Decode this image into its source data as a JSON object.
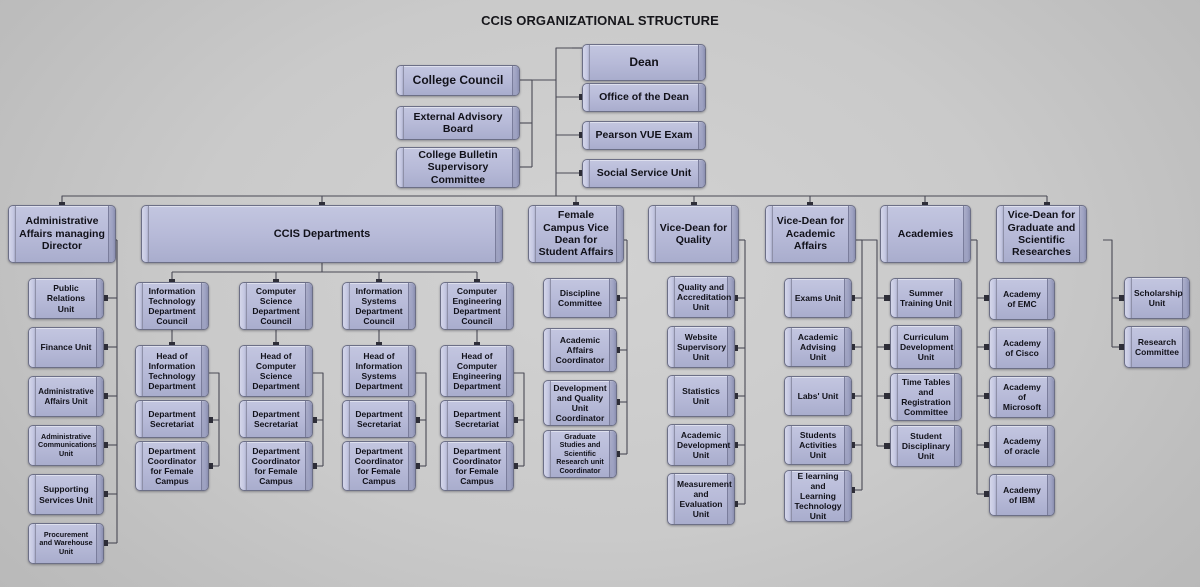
{
  "title": "CCIS ORGANIZATIONAL STRUCTURE",
  "colors": {
    "box_fill": "#b7bad8",
    "box_border": "#6c6f86",
    "background": "#cacaca",
    "connector": "#4a4a55",
    "text": "#111119"
  },
  "chart_data": {
    "type": "diagram",
    "title": "CCIS ORGANIZATIONAL STRUCTURE",
    "nodes": [
      {
        "id": "dean",
        "label": "Dean"
      },
      {
        "id": "office_of_dean",
        "label": "Office of the Dean"
      },
      {
        "id": "pearson_vue",
        "label": "Pearson VUE Exam"
      },
      {
        "id": "social_service",
        "label": "Social Service Unit"
      },
      {
        "id": "college_council",
        "label": "College Council"
      },
      {
        "id": "external_advisory",
        "label": "External Advisory Board"
      },
      {
        "id": "bulletin",
        "label": "College Bulletin Supervisory Committee"
      },
      {
        "id": "admin_affairs_dir",
        "label": "Administrative Affairs managing Director"
      },
      {
        "id": "ccis_departments",
        "label": "CCIS Departments"
      },
      {
        "id": "female_campus_vd",
        "label": "Female Campus Vice Dean for Student Affairs"
      },
      {
        "id": "vd_quality",
        "label": "Vice-Dean for Quality"
      },
      {
        "id": "vd_academic",
        "label": "Vice-Dean for Academic Affairs"
      },
      {
        "id": "academies",
        "label": "Academies"
      },
      {
        "id": "vd_graduate",
        "label": "Vice-Dean for Graduate and Scientific Researches"
      }
    ],
    "edges": [
      {
        "from": "dean",
        "to": "college_council"
      },
      {
        "from": "dean",
        "to": "external_advisory"
      },
      {
        "from": "dean",
        "to": "bulletin"
      },
      {
        "from": "dean",
        "to": "office_of_dean"
      },
      {
        "from": "dean",
        "to": "pearson_vue"
      },
      {
        "from": "dean",
        "to": "social_service"
      },
      {
        "from": "dean",
        "to": "admin_affairs_dir"
      },
      {
        "from": "dean",
        "to": "ccis_departments"
      },
      {
        "from": "dean",
        "to": "female_campus_vd"
      },
      {
        "from": "dean",
        "to": "vd_quality"
      },
      {
        "from": "dean",
        "to": "vd_academic"
      },
      {
        "from": "dean",
        "to": "academies"
      },
      {
        "from": "dean",
        "to": "vd_graduate"
      }
    ]
  },
  "top": {
    "dean": "Dean",
    "office_of_the_dean": "Office of the Dean",
    "pearson_vue_exam": "Pearson VUE Exam",
    "social_service_unit": "Social Service Unit",
    "college_council": "College Council",
    "external_advisory_board": "External Advisory Board",
    "college_bulletin": "College Bulletin Supervisory Committee"
  },
  "main_row": {
    "admin_affairs_director": "Administrative Affairs managing Director",
    "ccis_departments": "CCIS Departments",
    "female_campus_vice_dean": "Female Campus Vice Dean for Student Affairs",
    "vice_dean_quality": "Vice-Dean for Quality",
    "vice_dean_academic": "Vice-Dean for Academic Affairs",
    "academies": "Academies",
    "vice_dean_graduate": "Vice-Dean for Graduate and Scientific Researches"
  },
  "admin_units": [
    "Public Relations Unit",
    "Finance Unit",
    "Administrative Affairs Unit",
    "Administrative Communications Unit",
    "Supporting Services Unit",
    "Procurement and Warehouse Unit"
  ],
  "departments": [
    {
      "council": "Information Technology Department Council",
      "head": "Head of Information Technology Department",
      "secretariat": "Department Secretariat",
      "coordinator": "Department Coordinator for Female Campus"
    },
    {
      "council": "Computer Science Department Council",
      "head": "Head of Computer Science Department",
      "secretariat": "Department Secretariat",
      "coordinator": "Department Coordinator for Female Campus"
    },
    {
      "council": "Information Systems Department Council",
      "head": "Head of Information Systems Department",
      "secretariat": "Department Secretariat",
      "coordinator": "Department Coordinator for Female Campus"
    },
    {
      "council": "Computer Engineering Department Council",
      "head": "Head of Computer Engineering Department",
      "secretariat": "Department Secretariat",
      "coordinator": "Department Coordinator for Female Campus"
    }
  ],
  "female_campus_units": [
    "Discipline Committee",
    "Academic Affairs Coordinator",
    "Development and Quality Unit Coordinator",
    "Graduate Studies and Scientific Research unit Coordinator"
  ],
  "quality_units": [
    "Quality and Accreditation Unit",
    "Website Supervisory Unit",
    "Statistics Unit",
    "Academic Development Unit",
    "Measurement and Evaluation Unit"
  ],
  "academic_units_left": [
    "Exams Unit",
    "Academic Advising Unit",
    "Labs' Unit",
    "Students Activities Unit",
    "E learning and Learning Technology Unit"
  ],
  "academic_units_right": [
    "Summer Training Unit",
    "Curriculum Development Unit",
    "Time Tables and Registration Committee",
    "Student Disciplinary Unit"
  ],
  "academy_units": [
    "Academy of EMC",
    "Academy of Cisco",
    "Academy of Microsoft",
    "Academy of oracle",
    "Academy of IBM"
  ],
  "graduate_units": [
    "Scholarship Unit",
    "Research Committee"
  ]
}
